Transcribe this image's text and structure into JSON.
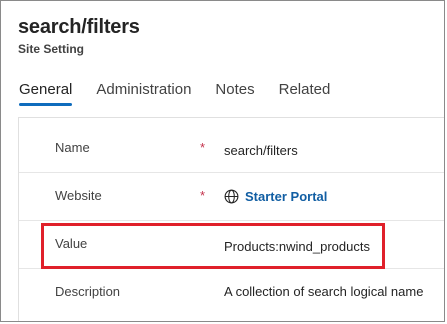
{
  "record": {
    "title": "search/filters",
    "entity": "Site Setting"
  },
  "tabs": [
    {
      "label": "General",
      "active": true
    },
    {
      "label": "Administration",
      "active": false
    },
    {
      "label": "Notes",
      "active": false
    },
    {
      "label": "Related",
      "active": false
    }
  ],
  "fields": {
    "name": {
      "label": "Name",
      "required_mark": "*",
      "value": "search/filters"
    },
    "website": {
      "label": "Website",
      "required_mark": "*",
      "value": "Starter Portal",
      "icon": "globe-icon"
    },
    "value": {
      "label": "Value",
      "value": "Products:nwind_products"
    },
    "description": {
      "label": "Description",
      "value": "A collection of search logical name"
    }
  },
  "colors": {
    "accent": "#0f6cbd",
    "link": "#115ea3",
    "required": "#c4314b",
    "highlight": "#e0202a"
  }
}
